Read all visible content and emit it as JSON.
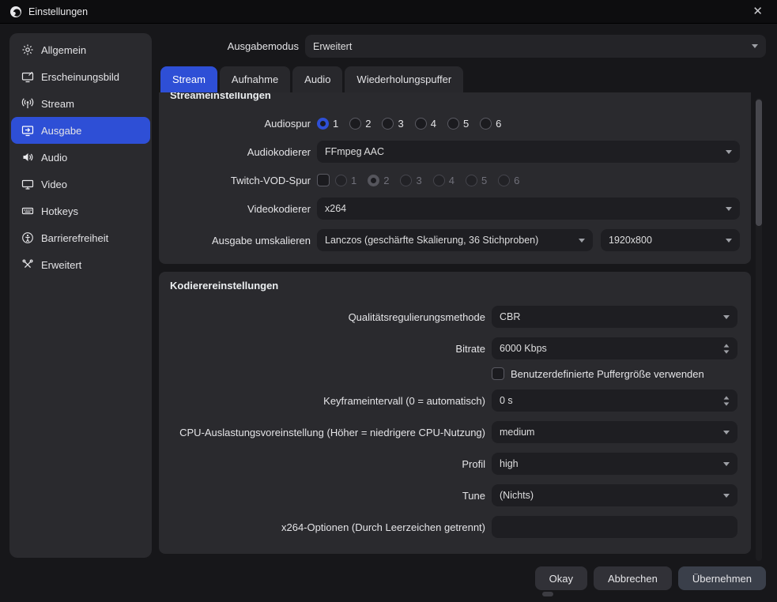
{
  "colors": {
    "accent": "#2e4fd6"
  },
  "window": {
    "title": "Einstellungen",
    "close": "✕"
  },
  "sidebar": {
    "items": [
      {
        "label": "Allgemein"
      },
      {
        "label": "Erscheinungsbild"
      },
      {
        "label": "Stream"
      },
      {
        "label": "Ausgabe"
      },
      {
        "label": "Audio"
      },
      {
        "label": "Video"
      },
      {
        "label": "Hotkeys"
      },
      {
        "label": "Barrierefreiheit"
      },
      {
        "label": "Erweitert"
      }
    ]
  },
  "output_mode": {
    "label": "Ausgabemodus",
    "value": "Erweitert"
  },
  "tabs": [
    {
      "label": "Stream"
    },
    {
      "label": "Aufnahme"
    },
    {
      "label": "Audio"
    },
    {
      "label": "Wiederholungspuffer"
    }
  ],
  "stream_section": {
    "title": "Streameinstellungen",
    "audio_track": {
      "label": "Audiospur",
      "options": [
        "1",
        "2",
        "3",
        "4",
        "5",
        "6"
      ],
      "selected": "1"
    },
    "audio_encoder": {
      "label": "Audiokodierer",
      "value": "FFmpeg AAC"
    },
    "twitch_vod": {
      "label": "Twitch-VOD-Spur",
      "checked": false,
      "options": [
        "1",
        "2",
        "3",
        "4",
        "5",
        "6"
      ],
      "selected": "2"
    },
    "video_encoder": {
      "label": "Videokodierer",
      "value": "x264"
    },
    "rescale": {
      "label": "Ausgabe umskalieren",
      "filter": "Lanczos (geschärfte Skalierung, 36 Stichproben)",
      "resolution": "1920x800"
    }
  },
  "encoder_section": {
    "title": "Kodierereinstellungen",
    "rate_control": {
      "label": "Qualitätsregulierungsmethode",
      "value": "CBR"
    },
    "bitrate": {
      "label": "Bitrate",
      "value": "6000 Kbps"
    },
    "custom_buffer": {
      "label": "Benutzerdefinierte Puffergröße verwenden",
      "checked": false
    },
    "keyframe_interval": {
      "label": "Keyframeintervall (0 = automatisch)",
      "value": "0 s"
    },
    "cpu_preset": {
      "label": "CPU-Auslastungsvoreinstellung (Höher = niedrigere CPU-Nutzung)",
      "value": "medium"
    },
    "profile": {
      "label": "Profil",
      "value": "high"
    },
    "tune": {
      "label": "Tune",
      "value": "(Nichts)"
    },
    "x264_options": {
      "label": "x264-Optionen (Durch Leerzeichen getrennt)",
      "value": ""
    }
  },
  "footer": {
    "ok": "Okay",
    "cancel": "Abbrechen",
    "apply": "Übernehmen"
  }
}
